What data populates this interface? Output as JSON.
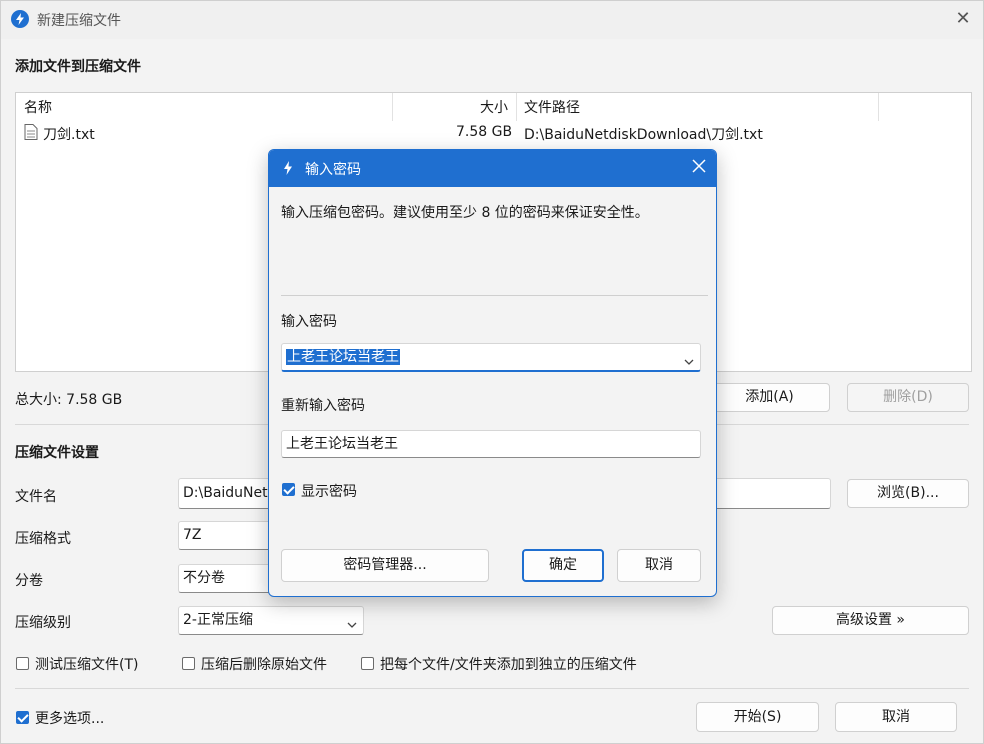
{
  "window": {
    "title": "新建压缩文件",
    "close_glyph": "✕"
  },
  "files_section": {
    "heading": "添加文件到压缩文件",
    "columns": {
      "name": "名称",
      "size": "大小",
      "path": "文件路径"
    },
    "rows": [
      {
        "name": "刀剑.txt",
        "size": "7.58 GB",
        "path": "D:\\BaiduNetdiskDownload\\刀剑.txt"
      }
    ],
    "total": "总大小: 7.58 GB",
    "add_button": "添加(A)",
    "delete_button": "删除(D)"
  },
  "settings": {
    "heading": "压缩文件设置",
    "filename_label": "文件名",
    "filename_value": "D:\\BaiduNet",
    "browse_button": "浏览(B)...",
    "format_label": "压缩格式",
    "format_value": "7Z",
    "split_label": "分卷",
    "split_value": "不分卷",
    "level_label": "压缩级别",
    "level_value": "2-正常压缩",
    "advanced_button": "高级设置 »",
    "test_checkbox": "测试压缩文件(T)",
    "delete_after_checkbox": "压缩后删除原始文件",
    "each_file_checkbox": "把每个文件/文件夹添加到独立的压缩文件"
  },
  "footer": {
    "more_options": "更多选项...",
    "start_button": "开始(S)",
    "cancel_button": "取消"
  },
  "password_dialog": {
    "title": "输入密码",
    "hint": "输入压缩包密码。建议使用至少 8 位的密码来保证安全性。",
    "password_label": "输入密码",
    "password_value": "上老王论坛当老王",
    "reenter_label": "重新输入密码",
    "reenter_value": "上老王论坛当老王",
    "show_password": "显示密码",
    "manager_button": "密码管理器...",
    "ok_button": "确定",
    "cancel_button": "取消"
  }
}
